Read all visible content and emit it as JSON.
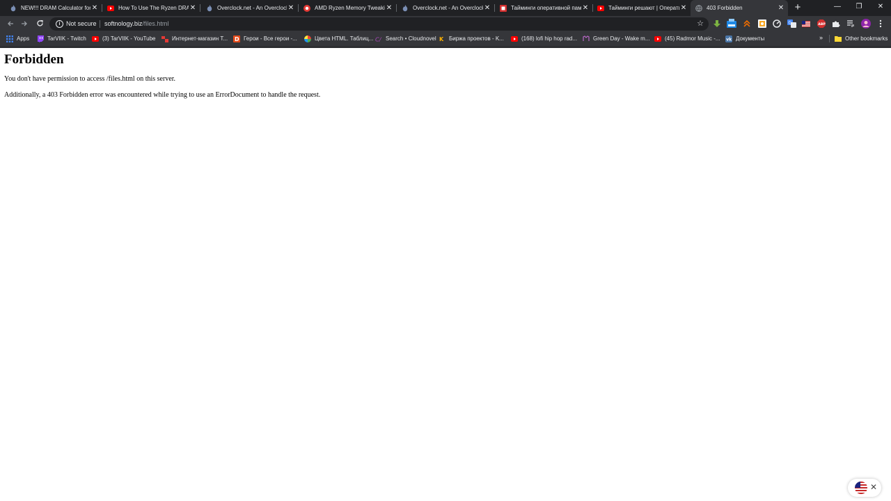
{
  "tabs": [
    {
      "title": "NEW!!! DRAM Calculator for R",
      "favicon": "overclock-flame-icon",
      "active": false
    },
    {
      "title": "How To Use The Ryzen DRAM",
      "favicon": "youtube-icon",
      "active": false
    },
    {
      "title": "Overclock.net - An Overclock",
      "favicon": "overclock-flame-icon",
      "active": false
    },
    {
      "title": "AMD Ryzen Memory Tweaking",
      "favicon": "amd-icon",
      "active": false
    },
    {
      "title": "Overclock.net - An Overclock",
      "favicon": "overclock-flame-icon",
      "active": false
    },
    {
      "title": "Тайминги оперативной памя",
      "favicon": "red-box-icon",
      "active": false
    },
    {
      "title": "Тайминги решают | Операти",
      "favicon": "youtube-icon",
      "active": false
    },
    {
      "title": "403 Forbidden",
      "favicon": "globe-icon",
      "active": true
    }
  ],
  "toolbar": {
    "security_label": "Not secure",
    "url_host": "softnology.biz",
    "url_path": "/files.html"
  },
  "bookmarks": {
    "items": [
      {
        "label": "Apps",
        "icon": "apps-grid-icon"
      },
      {
        "label": "TarVIIK - Twitch",
        "icon": "twitch-icon"
      },
      {
        "label": "(3) TarVIIK - YouTube",
        "icon": "youtube-icon"
      },
      {
        "label": "Интернет-магазин Т...",
        "icon": "store-icon"
      },
      {
        "label": "Герои - Все герои -...",
        "icon": "d-letter-icon"
      },
      {
        "label": "Цвета HTML. Таблиц...",
        "icon": "color-wheel-icon"
      },
      {
        "label": "Search • Cloudnovel",
        "icon": "cloudnovel-icon"
      },
      {
        "label": "Биржа проектов - K...",
        "icon": "k-letter-icon"
      },
      {
        "label": "(168) lofi hip hop rad...",
        "icon": "youtube-icon"
      },
      {
        "label": "Green Day - Wake m...",
        "icon": "music-icon"
      },
      {
        "label": "(45) Radmor Music -...",
        "icon": "youtube-icon"
      },
      {
        "label": "Документы",
        "icon": "vk-icon"
      }
    ],
    "other_label": "Other bookmarks"
  },
  "page": {
    "heading": "Forbidden",
    "message": "You don't have permission to access /files.html on this server.",
    "additional": "Additionally, a 403 Forbidden error was encountered while trying to use an ErrorDocument to handle the request."
  },
  "colors": {
    "frame": "#202124",
    "toolbar": "#35363a",
    "text_light": "#e8eaed",
    "youtube_red": "#ff0000",
    "twitch_purple": "#9146ff"
  }
}
